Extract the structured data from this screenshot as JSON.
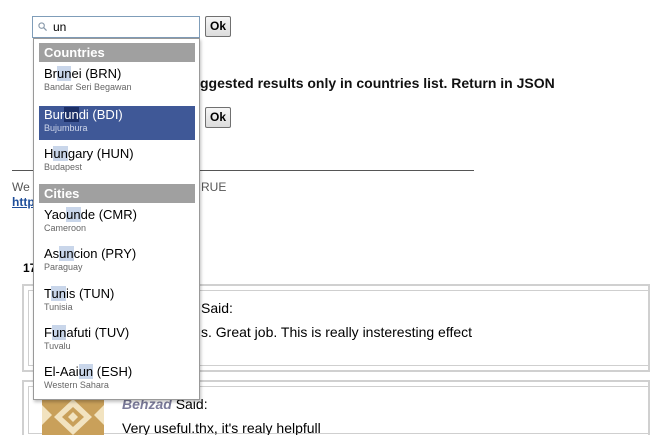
{
  "search": {
    "value": "un",
    "ok_label": "Ok"
  },
  "background": {
    "heading_fragment": "ggested results only in countries list. Return in JSON",
    "second_ok_label": "Ok",
    "we_fragment": "We",
    "true_fragment": "RUE",
    "http_fragment": "http",
    "count_fragment": "17"
  },
  "comments": [
    {
      "author": "",
      "said": "Said:",
      "text": "s. Great job. This is really insteresting effect"
    },
    {
      "author": "Behzad",
      "said": "Said:",
      "text": "Very useful.thx, it's realy helpfull"
    }
  ],
  "dropdown": {
    "groups": [
      {
        "label": "Countries",
        "items": [
          {
            "pre": "Br",
            "match": "un",
            "post": "ei (BRN)",
            "sub": "Bandar Seri Begawan"
          },
          {
            "pre": "Bur",
            "match": "un",
            "post": "di (BDI)",
            "sub": "Bujumbura"
          },
          {
            "pre": "H",
            "match": "un",
            "post": "gary (HUN)",
            "sub": "Budapest"
          }
        ]
      },
      {
        "label": "Cities",
        "items": [
          {
            "pre": "Yao",
            "match": "un",
            "post": "de (CMR)",
            "sub": "Cameroon"
          },
          {
            "pre": "As",
            "match": "un",
            "post": "cion (PRY)",
            "sub": "Paraguay"
          },
          {
            "pre": "T",
            "match": "un",
            "post": "is (TUN)",
            "sub": "Tunisia"
          },
          {
            "pre": "F",
            "match": "un",
            "post": "afuti (TUV)",
            "sub": "Tuvalu"
          },
          {
            "pre": "El-Aai",
            "match": "un",
            "post": " (ESH)",
            "sub": "Western Sahara"
          }
        ]
      }
    ],
    "selected_index": 1
  },
  "colors": {
    "selected_bg": "#3f5897",
    "group_header_bg": "#a0a0a0",
    "match_highlight": "#c9d6ea"
  }
}
